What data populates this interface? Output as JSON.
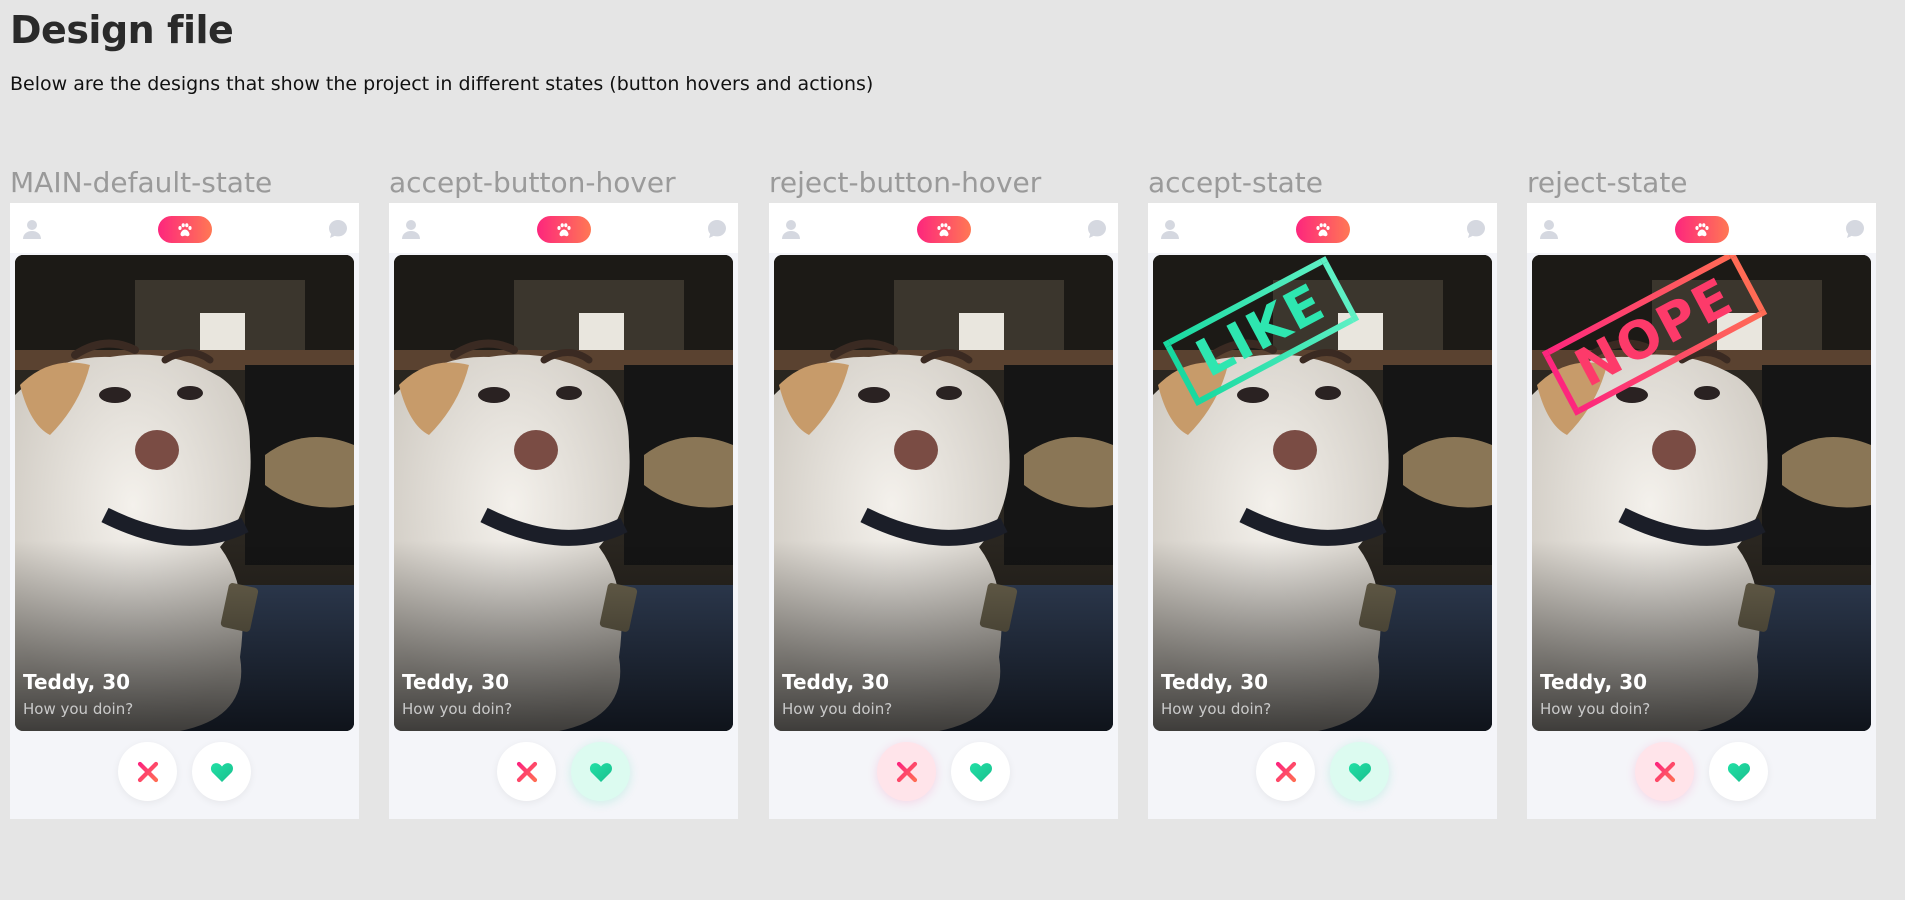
{
  "page": {
    "title": "Design file",
    "description": "Below are the designs that show the project in different states (button hovers and actions)"
  },
  "colors": {
    "background": "#e5e5e5",
    "brand_gradient_start": "#fd267d",
    "brand_gradient_end": "#ff7854",
    "accept_green": "#1ed9a0",
    "reject_red": "#fd3a6a",
    "reject_hover_bg": "#ffe4ea",
    "accept_hover_bg": "#dcfbf0"
  },
  "icons": {
    "top_left": "user-icon",
    "top_center": "paw-icon",
    "top_right": "chat-icon",
    "reject_button": "close-icon",
    "accept_button": "heart-icon"
  },
  "profile": {
    "name": "Teddy, 30",
    "bio": "How you doin?"
  },
  "panels": [
    {
      "label": "MAIN-default-state",
      "reject_hover": false,
      "accept_hover": false,
      "stamp": ""
    },
    {
      "label": "accept-button-hover",
      "reject_hover": false,
      "accept_hover": true,
      "stamp": ""
    },
    {
      "label": "reject-button-hover",
      "reject_hover": true,
      "accept_hover": false,
      "stamp": ""
    },
    {
      "label": "accept-state",
      "reject_hover": false,
      "accept_hover": true,
      "stamp": "LIKE"
    },
    {
      "label": "reject-state",
      "reject_hover": true,
      "accept_hover": false,
      "stamp": "NOPE"
    }
  ]
}
